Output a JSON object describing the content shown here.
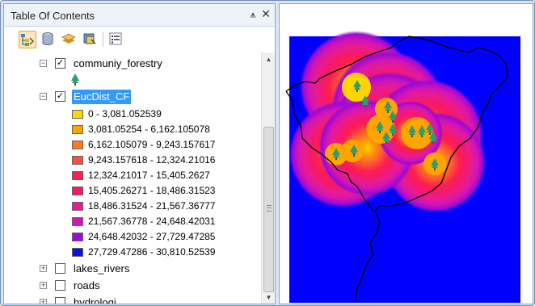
{
  "toc": {
    "title": "Table Of Contents",
    "pin_glyph": "⩚",
    "close_glyph": "✕",
    "toolbar_buttons": [
      "list-by-drawing-order-icon",
      "list-by-source-icon",
      "list-by-visibility-icon",
      "list-by-selection-icon",
      "options-icon"
    ]
  },
  "layers": [
    {
      "name": "communiy_forestry",
      "checked": true,
      "expanded": true
    },
    {
      "name": "EucDist_CF",
      "checked": true,
      "expanded": true,
      "selected": true
    },
    {
      "name": "lakes_rivers",
      "checked": false,
      "expanded": false
    },
    {
      "name": "roads",
      "checked": false,
      "expanded": false
    },
    {
      "name": "hydrologi...",
      "checked": false,
      "expanded": false
    }
  ],
  "legend": [
    {
      "label": "0 - 3,081.052539",
      "color": "#ffd400"
    },
    {
      "label": "3,081.05254 - 6,162.105078",
      "color": "#ffa500"
    },
    {
      "label": "6,162.105079 - 9,243.157617",
      "color": "#ff7a1e"
    },
    {
      "label": "9,243.157618 - 12,324.21016",
      "color": "#ff4e3a"
    },
    {
      "label": "12,324.21017 - 15,405.2627",
      "color": "#ff1f4e"
    },
    {
      "label": "15,405.26271 - 18,486.31523",
      "color": "#f5186a"
    },
    {
      "label": "18,486.31524 - 21,567.36777",
      "color": "#e81c8e"
    },
    {
      "label": "21,567.36778 - 24,648.42031",
      "color": "#d414b4"
    },
    {
      "label": "24,648.42032 - 27,729.47285",
      "color": "#9b0ad6"
    },
    {
      "label": "27,729.47286 - 30,810.52539",
      "color": "#1010e8"
    }
  ],
  "map": {
    "background": "#0000ff",
    "tree_icon": "conifer-tree-icon",
    "tree_color": "#2e9e6a"
  }
}
